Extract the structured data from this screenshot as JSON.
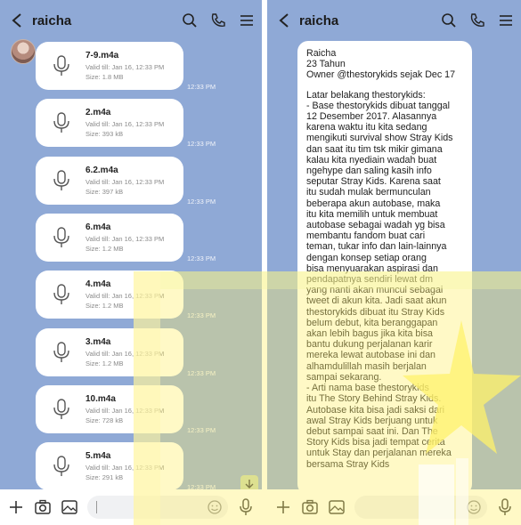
{
  "colors": {
    "chat_bg": "#8fa9d6",
    "bubble_bg": "#ffffff",
    "input_bar": "#ffffff",
    "overlay_yellow": "#ffef6a"
  },
  "left": {
    "header": {
      "title": "raicha"
    },
    "time": "12:33 PM",
    "files": [
      {
        "name": "7-9.m4a",
        "valid": "Valid till: Jan 16, 12:33 PM",
        "size": "Size: 1.8 MB"
      },
      {
        "name": "2.m4a",
        "valid": "Valid till: Jan 16, 12:33 PM",
        "size": "Size: 393 kB"
      },
      {
        "name": "6.2.m4a",
        "valid": "Valid till: Jan 16, 12:33 PM",
        "size": "Size: 397 kB"
      },
      {
        "name": "6.m4a",
        "valid": "Valid till: Jan 16, 12:33 PM",
        "size": "Size: 1.2 MB"
      },
      {
        "name": "4.m4a",
        "valid": "Valid till: Jan 16, 12:33 PM",
        "size": "Size: 1.2 MB"
      },
      {
        "name": "3.m4a",
        "valid": "Valid till: Jan 16, 12:33 PM",
        "size": "Size: 1.2 MB"
      },
      {
        "name": "10.m4a",
        "valid": "Valid till: Jan 16, 12:33 PM",
        "size": "Size: 728 kB"
      },
      {
        "name": "5.m4a",
        "valid": "Valid till: Jan 16, 12:33 PM",
        "size": "Size: 291 kB"
      }
    ]
  },
  "right": {
    "header": {
      "title": "raicha"
    },
    "message_lines": [
      "Raicha",
      "23 Tahun",
      "Owner @thestorykids sejak Dec 17",
      "",
      "Latar belakang thestorykids:",
      "- Base thestorykids dibuat tanggal",
      "12 Desember 2017. Alasannya",
      "karena waktu itu kita sedang",
      "mengikuti survival show Stray Kids",
      "dan saat itu tim tsk mikir gimana",
      "kalau kita nyediain wadah buat",
      "ngehype dan saling kasih info",
      "seputar Stray Kids. Karena saat",
      "itu  sudah mulak bermunculan",
      "beberapa akun autobase, maka",
      "itu kita memilih untuk membuat",
      "autobase sebagai wadah yg bisa",
      "membantu fandom buat cari",
      "teman, tukar info dan lain-lainnya",
      "dengan konsep setiap orang",
      "bisa menyuarakan aspirasi dan",
      "pendapatnya sendiri lewat dm",
      "yang nanti akan muncul sebagai",
      "tweet di akun kita. Jadi saat akun",
      "thestorykids dibuat itu Stray Kids",
      "belum debut, kita beranggapan",
      "akan lebih bagus jika kita bisa",
      "bantu dukung perjalanan karir",
      "mereka lewat autobase ini dan",
      "alhamdulillah masih berjalan",
      "sampai sekarang.",
      "- Arti nama base thestorykids",
      "itu The Story Behind Stray Kids.",
      "Autobase kita bisa jadi saksi dari",
      "awal Stray Kids berjuang untuk",
      "debut sampai saat ini. Dan The",
      "Story Kids bisa jadi tempat cerita",
      "untuk Stay dan perjalanan mereka",
      "bersama Stray Kids"
    ]
  }
}
